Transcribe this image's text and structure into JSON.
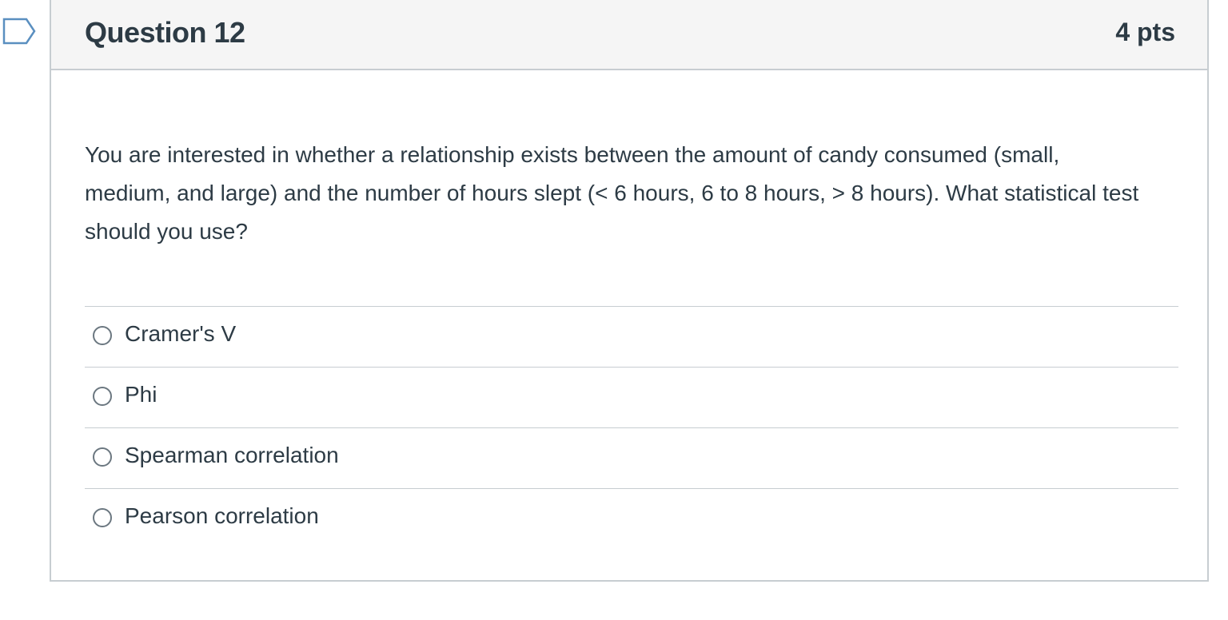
{
  "question": {
    "title": "Question 12",
    "points": "4 pts",
    "text": "You are interested in whether a relationship exists between the amount of candy consumed (small, medium, and large) and the number of hours slept (< 6 hours, 6 to 8 hours, > 8 hours). What statistical test should you use?",
    "flag_icon": "bookmark-flag-icon"
  },
  "answers": [
    {
      "label": "Cramer's V"
    },
    {
      "label": "Phi"
    },
    {
      "label": "Spearman correlation"
    },
    {
      "label": "Pearson correlation"
    }
  ],
  "colors": {
    "text": "#2d3b45",
    "header_bg": "#f5f5f5",
    "border": "#c7cdd1",
    "flag_outline": "#5a8fc0"
  }
}
